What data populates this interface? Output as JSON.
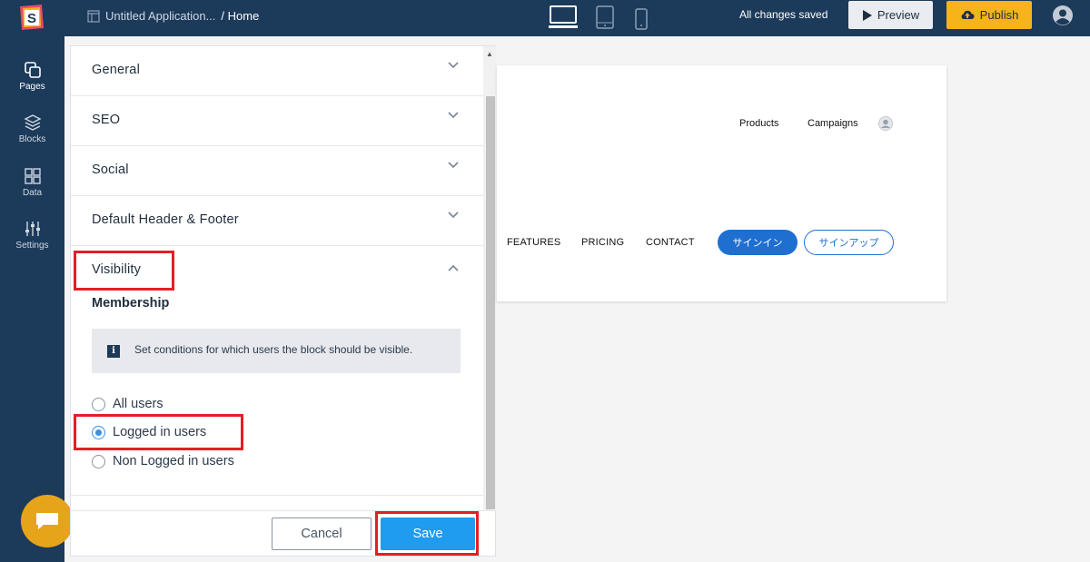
{
  "topbar": {
    "app_name": "Untitled Application...",
    "breadcrumb": "/ Home",
    "status": "All changes saved",
    "preview_label": "Preview",
    "publish_label": "Publish",
    "logo_letter": "S"
  },
  "leftnav": {
    "items": [
      {
        "label": "Pages",
        "icon": "pages-icon"
      },
      {
        "label": "Blocks",
        "icon": "blocks-icon"
      },
      {
        "label": "Data",
        "icon": "data-icon"
      },
      {
        "label": "Settings",
        "icon": "settings-sliders-icon"
      }
    ]
  },
  "panel": {
    "sections": [
      {
        "label": "General",
        "expanded": false
      },
      {
        "label": "SEO",
        "expanded": false
      },
      {
        "label": "Social",
        "expanded": false
      },
      {
        "label": "Default Header & Footer",
        "expanded": false
      },
      {
        "label": "Visibility",
        "expanded": true
      }
    ],
    "membership_title": "Membership",
    "info_text": "Set conditions for which users the block should be visible.",
    "info_icon": "i",
    "options": [
      {
        "label": "All users",
        "checked": false
      },
      {
        "label": "Logged in users",
        "checked": true
      },
      {
        "label": "Non Logged in users",
        "checked": false
      }
    ],
    "cancel_label": "Cancel",
    "save_label": "Save"
  },
  "preview": {
    "top_links": [
      "Products",
      "Campaigns"
    ],
    "nav_links": [
      "FEATURES",
      "PRICING",
      "CONTACT"
    ],
    "signin_label": "サインイン",
    "signup_label": "サインアップ"
  },
  "colors": {
    "topbar_bg": "#1c3a5a",
    "publish_bg": "#f6b31a",
    "save_bg": "#1f9bf0",
    "highlight": "#e41e26",
    "signin_bg": "#1f6fd0"
  }
}
